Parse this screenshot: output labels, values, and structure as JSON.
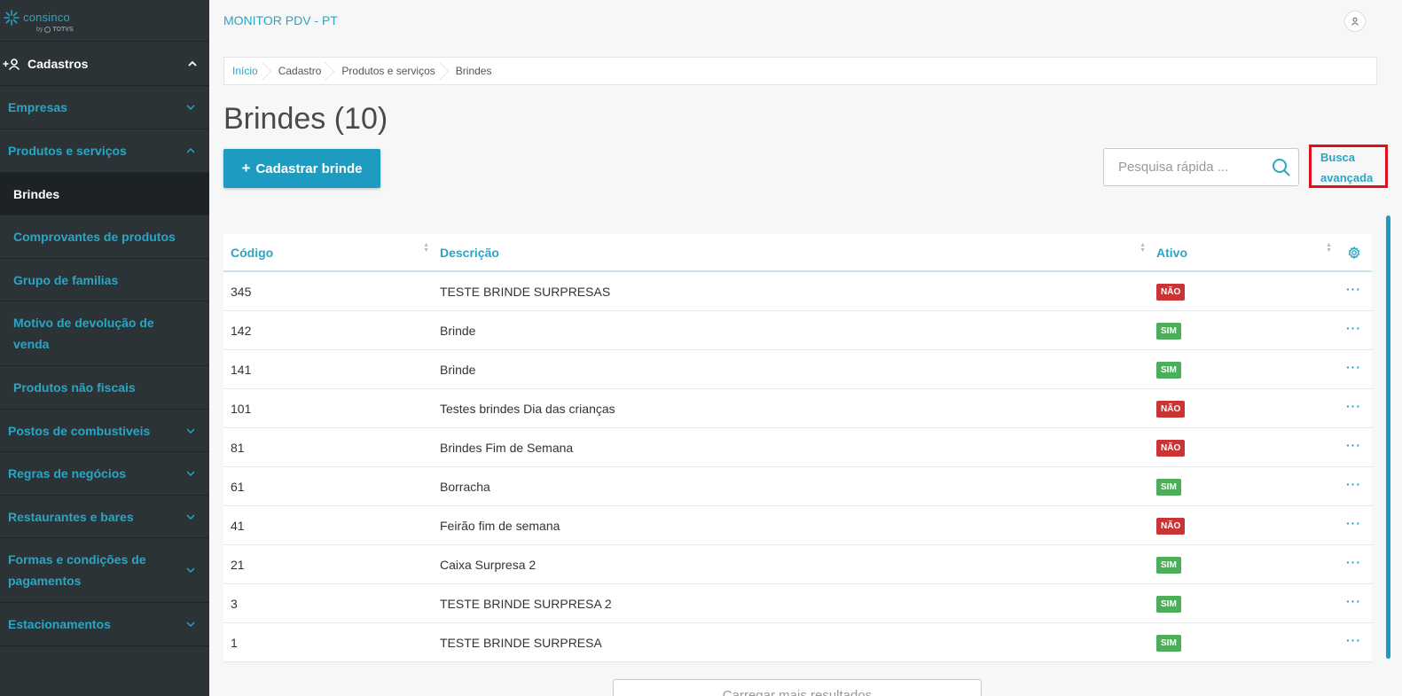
{
  "sidebar": {
    "logo_name": "consinco",
    "logo_by": "by",
    "logo_totvs": "TOTVS",
    "section": {
      "label": "Cadastros",
      "icon": "user-add-icon"
    },
    "items": [
      {
        "label": "Empresas",
        "type": "group",
        "expanded": false
      },
      {
        "label": "Produtos e serviços",
        "type": "group",
        "expanded": true
      },
      {
        "label": "Brindes",
        "type": "sub",
        "active": true
      },
      {
        "label": "Comprovantes de produtos",
        "type": "sub"
      },
      {
        "label": "Grupo de familias",
        "type": "sub"
      },
      {
        "label": "Motivo de devolução de venda",
        "type": "sub"
      },
      {
        "label": "Produtos não fiscais",
        "type": "sub"
      },
      {
        "label": "Postos de combustiveis",
        "type": "group",
        "expanded": false
      },
      {
        "label": "Regras de negócios",
        "type": "group",
        "expanded": false
      },
      {
        "label": "Restaurantes e bares",
        "type": "group",
        "expanded": false
      },
      {
        "label": "Formas e condições de pagamentos",
        "type": "group",
        "expanded": false
      },
      {
        "label": "Estacionamentos",
        "type": "group",
        "expanded": false
      }
    ]
  },
  "header": {
    "app_title": "MONITOR PDV - PT",
    "user_icon": "user-icon"
  },
  "breadcrumb": [
    "Início",
    "Cadastro",
    "Produtos e serviços",
    "Brindes"
  ],
  "page": {
    "title": "Brindes (10)",
    "add_button": "Cadastrar brinde",
    "search_placeholder": "Pesquisa rápida ...",
    "advanced_search_line1": "Busca",
    "advanced_search_line2": "avançada",
    "load_more": "Carregar mais resultados"
  },
  "table": {
    "columns": [
      "Código",
      "Descrição",
      "Ativo"
    ],
    "rows": [
      {
        "codigo": "345",
        "descricao": "TESTE BRINDE SURPRESAS",
        "ativo": "NÃO"
      },
      {
        "codigo": "142",
        "descricao": "Brinde",
        "ativo": "SIM"
      },
      {
        "codigo": "141",
        "descricao": "Brinde",
        "ativo": "SIM"
      },
      {
        "codigo": "101",
        "descricao": "Testes brindes Dia das crianças",
        "ativo": "NÃO"
      },
      {
        "codigo": "81",
        "descricao": "Brindes Fim de Semana",
        "ativo": "NÃO"
      },
      {
        "codigo": "61",
        "descricao": "Borracha",
        "ativo": "SIM"
      },
      {
        "codigo": "41",
        "descricao": "Feirão fim de semana",
        "ativo": "NÃO"
      },
      {
        "codigo": "21",
        "descricao": "Caixa Surpresa 2",
        "ativo": "SIM"
      },
      {
        "codigo": "3",
        "descricao": "TESTE BRINDE SURPRESA 2",
        "ativo": "SIM"
      },
      {
        "codigo": "1",
        "descricao": "TESTE BRINDE SURPRESA",
        "ativo": "SIM"
      }
    ]
  },
  "colors": {
    "accent": "#2aa6c4",
    "sidebar_bg": "#2b3337",
    "no_badge": "#c93434",
    "yes_badge": "#4cad5b",
    "highlight": "#e0101c"
  }
}
